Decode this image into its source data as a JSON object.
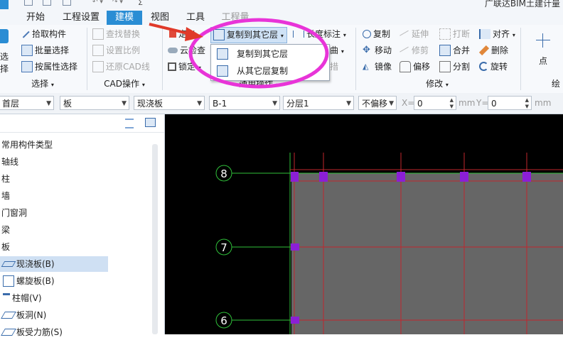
{
  "app": {
    "title": "广联达BIM土建计量"
  },
  "tabs": [
    {
      "label": "开始"
    },
    {
      "label": "工程设置"
    },
    {
      "label": "建模",
      "active": true
    },
    {
      "label": "视图"
    },
    {
      "label": "工具"
    },
    {
      "label": "工程量"
    }
  ],
  "ribbon": {
    "select_group": {
      "label": "选择",
      "big_button": "选择",
      "items": [
        "拾取构件",
        "批量选择",
        "按属性选择"
      ]
    },
    "cad_group": {
      "label": "CAD操作",
      "items": [
        "查找替换",
        "设置比例",
        "还原CAD线"
      ]
    },
    "common_group": {
      "label": "通用操作",
      "items_partial": [
        "定义",
        "云检查",
        "锁定"
      ],
      "copy_to_floor": "复制到其它层",
      "dimension": "长度标注",
      "partial_right": [
        "曲",
        "措"
      ]
    },
    "modify_group": {
      "label": "修改",
      "items": [
        "复制",
        "延伸",
        "打断",
        "对齐",
        "移动",
        "修剪",
        "合并",
        "删除",
        "镜像",
        "偏移",
        "分割",
        "旋转"
      ]
    },
    "draw_group": {
      "label": "绘",
      "point": "点"
    }
  },
  "dropdown": {
    "items": [
      "复制到其它层",
      "从其它层复制"
    ]
  },
  "propbar": {
    "floor": "首层",
    "category": "板",
    "type": "现浇板",
    "name": "B-1",
    "layer": "分层1",
    "offset": "不偏移",
    "x_label": "X=",
    "x_value": "0",
    "y_label": "Y=",
    "y_value": "0",
    "unit": "mm"
  },
  "tree": {
    "header": "常用构件类型",
    "items": [
      "轴线",
      "柱",
      "墙",
      "门窗洞",
      "梁",
      "板"
    ],
    "children": [
      {
        "label": "现浇板(B)",
        "selected": true
      },
      {
        "label": "螺旋板(B)"
      },
      {
        "label": "柱帽(V)"
      },
      {
        "label": "板洞(N)"
      },
      {
        "label": "板受力筋(S)"
      }
    ]
  },
  "canvas": {
    "axis_labels": [
      "8",
      "7",
      "6"
    ],
    "colors": {
      "background": "#000000",
      "slab": "#666666",
      "grid": "#c0262d",
      "node": "#8b1fd6",
      "axis": "#2fbf3a",
      "highlight": "#e834d8"
    }
  }
}
